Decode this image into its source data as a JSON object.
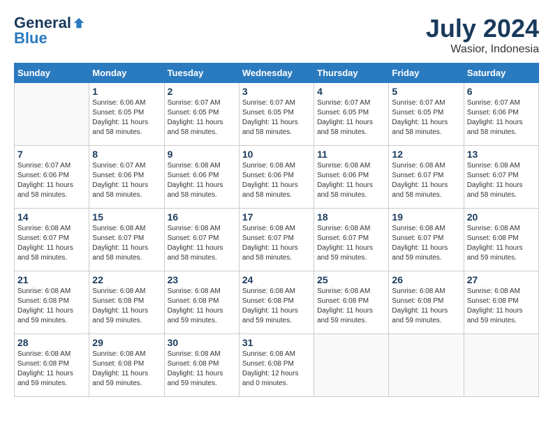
{
  "header": {
    "logo_general": "General",
    "logo_blue": "Blue",
    "month_title": "July 2024",
    "location": "Wasior, Indonesia"
  },
  "calendar": {
    "days_of_week": [
      "Sunday",
      "Monday",
      "Tuesday",
      "Wednesday",
      "Thursday",
      "Friday",
      "Saturday"
    ],
    "weeks": [
      [
        {
          "day": "",
          "info": ""
        },
        {
          "day": "1",
          "info": "Sunrise: 6:06 AM\nSunset: 6:05 PM\nDaylight: 11 hours\nand 58 minutes."
        },
        {
          "day": "2",
          "info": "Sunrise: 6:07 AM\nSunset: 6:05 PM\nDaylight: 11 hours\nand 58 minutes."
        },
        {
          "day": "3",
          "info": "Sunrise: 6:07 AM\nSunset: 6:05 PM\nDaylight: 11 hours\nand 58 minutes."
        },
        {
          "day": "4",
          "info": "Sunrise: 6:07 AM\nSunset: 6:05 PM\nDaylight: 11 hours\nand 58 minutes."
        },
        {
          "day": "5",
          "info": "Sunrise: 6:07 AM\nSunset: 6:05 PM\nDaylight: 11 hours\nand 58 minutes."
        },
        {
          "day": "6",
          "info": "Sunrise: 6:07 AM\nSunset: 6:06 PM\nDaylight: 11 hours\nand 58 minutes."
        }
      ],
      [
        {
          "day": "7",
          "info": "Sunrise: 6:07 AM\nSunset: 6:06 PM\nDaylight: 11 hours\nand 58 minutes."
        },
        {
          "day": "8",
          "info": "Sunrise: 6:07 AM\nSunset: 6:06 PM\nDaylight: 11 hours\nand 58 minutes."
        },
        {
          "day": "9",
          "info": "Sunrise: 6:08 AM\nSunset: 6:06 PM\nDaylight: 11 hours\nand 58 minutes."
        },
        {
          "day": "10",
          "info": "Sunrise: 6:08 AM\nSunset: 6:06 PM\nDaylight: 11 hours\nand 58 minutes."
        },
        {
          "day": "11",
          "info": "Sunrise: 6:08 AM\nSunset: 6:06 PM\nDaylight: 11 hours\nand 58 minutes."
        },
        {
          "day": "12",
          "info": "Sunrise: 6:08 AM\nSunset: 6:07 PM\nDaylight: 11 hours\nand 58 minutes."
        },
        {
          "day": "13",
          "info": "Sunrise: 6:08 AM\nSunset: 6:07 PM\nDaylight: 11 hours\nand 58 minutes."
        }
      ],
      [
        {
          "day": "14",
          "info": "Sunrise: 6:08 AM\nSunset: 6:07 PM\nDaylight: 11 hours\nand 58 minutes."
        },
        {
          "day": "15",
          "info": "Sunrise: 6:08 AM\nSunset: 6:07 PM\nDaylight: 11 hours\nand 58 minutes."
        },
        {
          "day": "16",
          "info": "Sunrise: 6:08 AM\nSunset: 6:07 PM\nDaylight: 11 hours\nand 58 minutes."
        },
        {
          "day": "17",
          "info": "Sunrise: 6:08 AM\nSunset: 6:07 PM\nDaylight: 11 hours\nand 58 minutes."
        },
        {
          "day": "18",
          "info": "Sunrise: 6:08 AM\nSunset: 6:07 PM\nDaylight: 11 hours\nand 59 minutes."
        },
        {
          "day": "19",
          "info": "Sunrise: 6:08 AM\nSunset: 6:07 PM\nDaylight: 11 hours\nand 59 minutes."
        },
        {
          "day": "20",
          "info": "Sunrise: 6:08 AM\nSunset: 6:08 PM\nDaylight: 11 hours\nand 59 minutes."
        }
      ],
      [
        {
          "day": "21",
          "info": "Sunrise: 6:08 AM\nSunset: 6:08 PM\nDaylight: 11 hours\nand 59 minutes."
        },
        {
          "day": "22",
          "info": "Sunrise: 6:08 AM\nSunset: 6:08 PM\nDaylight: 11 hours\nand 59 minutes."
        },
        {
          "day": "23",
          "info": "Sunrise: 6:08 AM\nSunset: 6:08 PM\nDaylight: 11 hours\nand 59 minutes."
        },
        {
          "day": "24",
          "info": "Sunrise: 6:08 AM\nSunset: 6:08 PM\nDaylight: 11 hours\nand 59 minutes."
        },
        {
          "day": "25",
          "info": "Sunrise: 6:08 AM\nSunset: 6:08 PM\nDaylight: 11 hours\nand 59 minutes."
        },
        {
          "day": "26",
          "info": "Sunrise: 6:08 AM\nSunset: 6:08 PM\nDaylight: 11 hours\nand 59 minutes."
        },
        {
          "day": "27",
          "info": "Sunrise: 6:08 AM\nSunset: 6:08 PM\nDaylight: 11 hours\nand 59 minutes."
        }
      ],
      [
        {
          "day": "28",
          "info": "Sunrise: 6:08 AM\nSunset: 6:08 PM\nDaylight: 11 hours\nand 59 minutes."
        },
        {
          "day": "29",
          "info": "Sunrise: 6:08 AM\nSunset: 6:08 PM\nDaylight: 11 hours\nand 59 minutes."
        },
        {
          "day": "30",
          "info": "Sunrise: 6:08 AM\nSunset: 6:08 PM\nDaylight: 11 hours\nand 59 minutes."
        },
        {
          "day": "31",
          "info": "Sunrise: 6:08 AM\nSunset: 6:08 PM\nDaylight: 12 hours\nand 0 minutes."
        },
        {
          "day": "",
          "info": ""
        },
        {
          "day": "",
          "info": ""
        },
        {
          "day": "",
          "info": ""
        }
      ]
    ]
  }
}
